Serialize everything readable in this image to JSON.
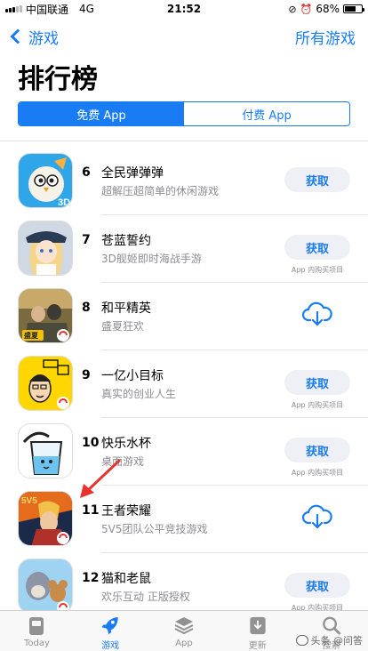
{
  "status_bar": {
    "carrier": "中国联通",
    "network": "4G",
    "time": "21:52",
    "battery": "68%",
    "battery_level": 0.68
  },
  "nav": {
    "back_label": "游戏",
    "right_label": "所有游戏"
  },
  "page_title": "排行榜",
  "segments": [
    {
      "label": "免费 App",
      "active": true
    },
    {
      "label": "付费 App",
      "active": false
    }
  ],
  "get_label": "获取",
  "iap_label": "App 内购买项目",
  "apps": [
    {
      "rank": "6",
      "name": "全民弹弹弹",
      "subtitle": "超解压超简单的休闲游戏",
      "action": "get",
      "iap": false
    },
    {
      "rank": "7",
      "name": "苍蓝誓约",
      "subtitle": "3D舰姬即时海战手游",
      "action": "get",
      "iap": true
    },
    {
      "rank": "8",
      "name": "和平精英",
      "subtitle": "盛夏狂欢",
      "action": "download",
      "iap": false
    },
    {
      "rank": "9",
      "name": "一亿小目标",
      "subtitle": "真实的创业人生",
      "action": "get",
      "iap": true
    },
    {
      "rank": "10",
      "name": "快乐水杯",
      "subtitle": "桌面游戏",
      "action": "get",
      "iap": true
    },
    {
      "rank": "11",
      "name": "王者荣耀",
      "subtitle": "5V5团队公平竞技游戏",
      "action": "download",
      "iap": false
    },
    {
      "rank": "12",
      "name": "猫和老鼠",
      "subtitle": "欢乐互动 正版授权",
      "action": "get",
      "iap": true
    }
  ],
  "tabs": [
    {
      "label": "Today",
      "icon": "today-icon",
      "active": false
    },
    {
      "label": "游戏",
      "icon": "rocket-icon",
      "active": true
    },
    {
      "label": "App",
      "icon": "layers-icon",
      "active": false
    },
    {
      "label": "更新",
      "icon": "download-tray-icon",
      "active": false
    },
    {
      "label": "搜索",
      "icon": "search-icon",
      "active": false
    }
  ],
  "watermark": "头条 @问答",
  "colors": {
    "accent": "#1a7cf5",
    "arrow": "#e8322d"
  }
}
